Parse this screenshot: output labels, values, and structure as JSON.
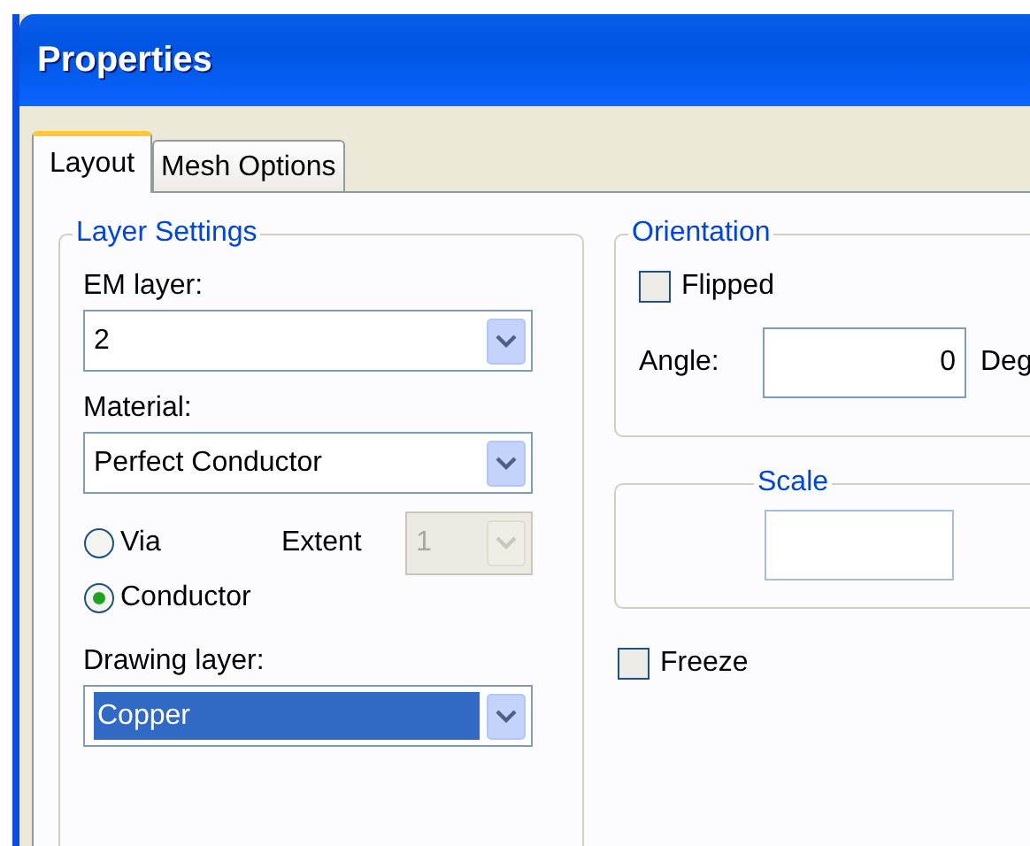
{
  "window": {
    "title": "Properties"
  },
  "tabs": [
    {
      "label": "Layout",
      "selected": true
    },
    {
      "label": "Mesh Options",
      "selected": false
    }
  ],
  "layer_settings": {
    "title": "Layer Settings",
    "em_layer": {
      "label": "EM layer:",
      "value": "2",
      "focused": false
    },
    "material": {
      "label": "Material:",
      "value": "Perfect Conductor",
      "focused": false
    },
    "type_options": [
      {
        "label": "Via",
        "selected": false
      },
      {
        "label": "Conductor",
        "selected": true
      }
    ],
    "extent": {
      "label": "Extent",
      "value": "1",
      "disabled": true
    },
    "drawing_layer": {
      "label": "Drawing layer:",
      "value": "Copper",
      "focused": true
    }
  },
  "orientation": {
    "title": "Orientation",
    "flipped": {
      "label": "Flipped",
      "checked": false
    },
    "angle": {
      "label": "Angle:",
      "value": "0",
      "unit": "Deg"
    }
  },
  "scale": {
    "title": "Scale"
  },
  "freeze": {
    "label": "Freeze",
    "checked": false
  }
}
